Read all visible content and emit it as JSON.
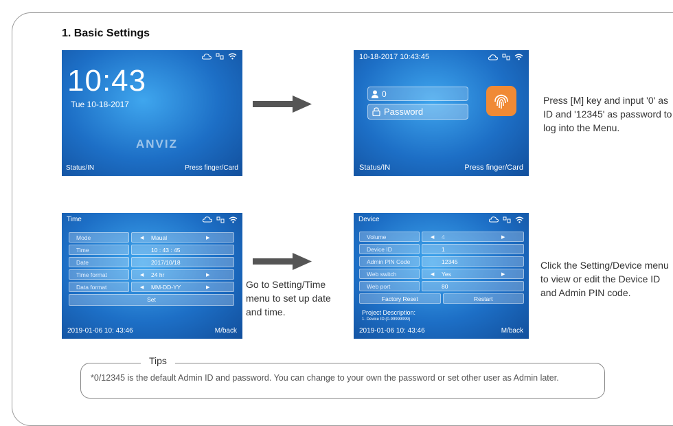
{
  "section": {
    "title": "1. Basic Settings"
  },
  "standby_screen": {
    "time": "10:43",
    "date": "Tue 10-18-2017",
    "logo": "ANVIZ",
    "status_left": "Status/IN",
    "status_right": "Press finger/Card",
    "icons": [
      "cloud-icon",
      "network-icon",
      "wifi-icon"
    ]
  },
  "login_screen": {
    "datetime": "10-18-2017 10:43:45",
    "id_value": "0",
    "password_placeholder": "Password",
    "status_left": "Status/IN",
    "status_right": "Press finger/Card",
    "fingerprint_color": "#f08a35"
  },
  "login_caption": "Press [M] key and input '0' as ID and '12345' as password to log into the Menu.",
  "time_screen": {
    "title": "Time",
    "rows": [
      {
        "label": "Mode",
        "value": "Maual",
        "arrows": true
      },
      {
        "label": "Time",
        "value": "10 : 43 : 45",
        "arrows": false
      },
      {
        "label": "Date",
        "value": "2017/10/18",
        "arrows": false
      },
      {
        "label": "Time format",
        "value": "24 hr",
        "arrows": true
      },
      {
        "label": "Data format",
        "value": "MM-DD-YY",
        "arrows": true
      }
    ],
    "set_label": "Set",
    "footer_time": "2019-01-06 10: 43:46",
    "footer_back": "M/back"
  },
  "time_caption": "Go to Setting/Time menu to set up date and time.",
  "device_screen": {
    "title": "Device",
    "rows": [
      {
        "label": "Volume",
        "value": "4",
        "arrows": true
      },
      {
        "label": "Device ID",
        "value": "1",
        "arrows": false
      },
      {
        "label": "Admin PIN Code",
        "value": "12345",
        "arrows": false
      },
      {
        "label": "Web switch",
        "value": "Yes",
        "arrows": true
      },
      {
        "label": "Web port",
        "value": "80",
        "arrows": false
      }
    ],
    "factory_reset_label": "Factory Reset",
    "restart_label": "Restart",
    "project_description": "Project Description:",
    "project_line": "1. Device ID:(0-99999999)",
    "footer_time": "2019-01-06 10: 43:46",
    "footer_back": "M/back"
  },
  "device_caption": "Click the Setting/Device menu to view or edit the Device ID and Admin PIN code.",
  "tips": {
    "title": "Tips",
    "text": "*0/12345 is the default Admin ID and password. You can change to your own the password or set other user as Admin later."
  }
}
